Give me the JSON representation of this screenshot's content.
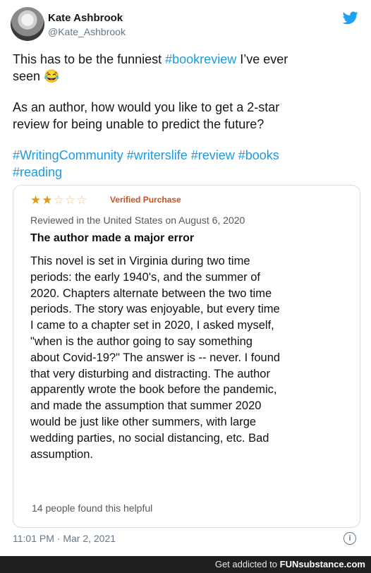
{
  "author": {
    "name": "Kate Ashbrook",
    "handle": "@Kate_Ashbrook"
  },
  "tweet": {
    "line1_prefix": "This has to be the funniest ",
    "line1_tag": "#bookreview",
    "line1_suffix": " I’ve ever",
    "line2": "seen 😂",
    "para2_line1": "As an author, how would you like to get a 2-star",
    "para2_line2": "review for being unable to predict the future?",
    "hashtags_line1": "#WritingCommunity #writerslife #review #books",
    "hashtags_line2": "#reading"
  },
  "review": {
    "rating": 2,
    "max_rating": 5,
    "verified": "Verified Purchase",
    "reviewed": "Reviewed in the United States on August 6, 2020",
    "title": "The author made a major error",
    "body_lines": [
      "This novel is set in Virginia during two time",
      "periods: the early 1940's, and the summer of",
      "2020. Chapters alternate between the two time",
      "periods. The story was enjoyable, but every time",
      "I came to a chapter set in 2020, I asked myself,",
      "\"when is the author going to say something",
      "about Covid-19?\" The answer is -- never. I found",
      "that very disturbing and distracting. The author",
      "apparently wrote the book before the pandemic,",
      "and made the assumption that summer 2020",
      "would be just like other summers, with large",
      "wedding parties, no social distancing, etc. Bad",
      "assumption."
    ],
    "helpful": "14 people found this helpful"
  },
  "meta": {
    "timestamp": "11:01 PM · Mar 2, 2021",
    "info_icon": "i"
  },
  "footer": {
    "prefix": "Get addicted to ",
    "brand": "FUNsubstance.com"
  },
  "colors": {
    "link": "#1c9be0",
    "star": "#e09a13",
    "verified": "#c7511f",
    "footer_bg": "#1f1f1f"
  }
}
